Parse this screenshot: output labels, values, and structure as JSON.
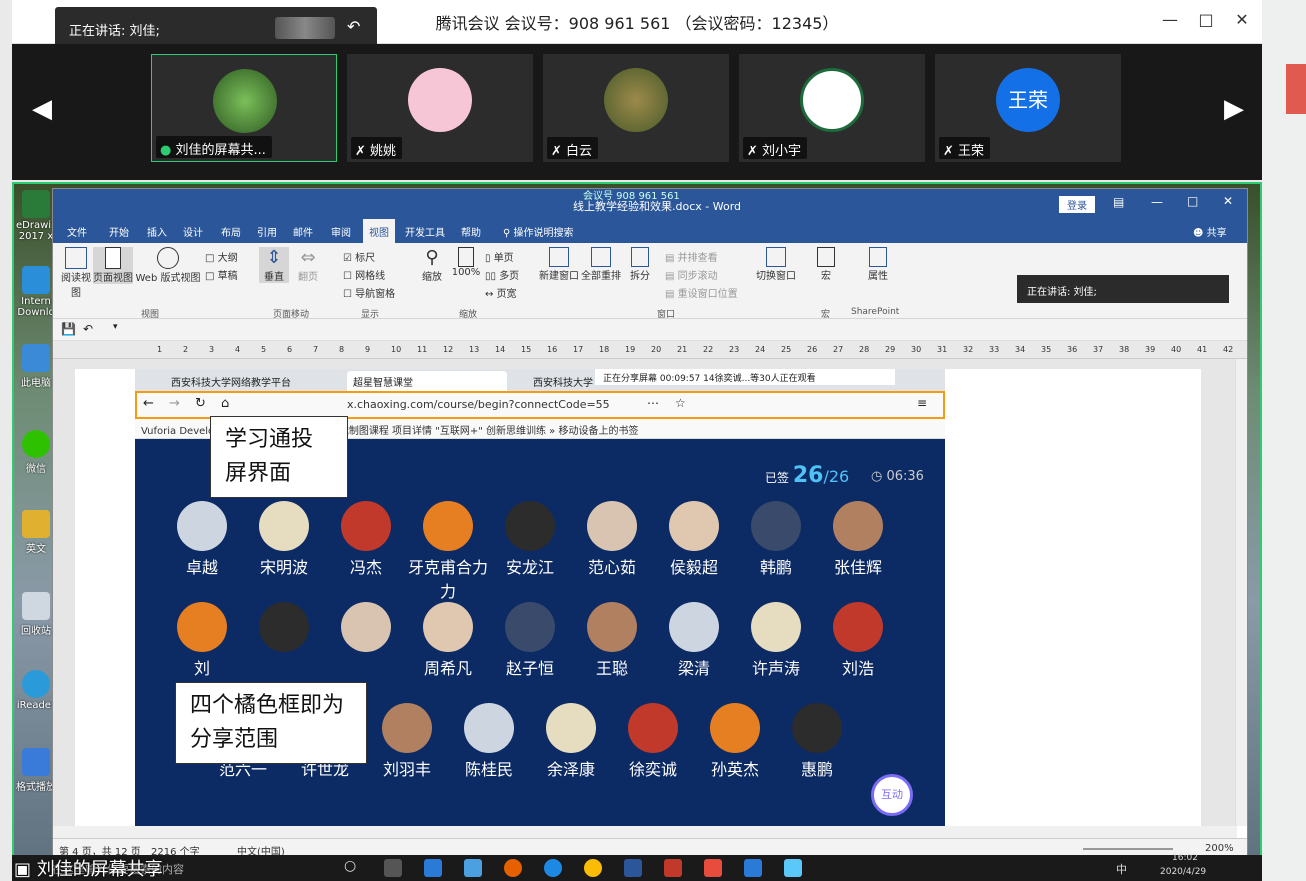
{
  "meeting": {
    "title": "腾讯会议 会议号：908 961 561 （会议密码：12345）",
    "speaking": "正在讲话: 刘佳;"
  },
  "participants": [
    {
      "name": "刘佳的屏幕共...",
      "color": "#4b7a3a",
      "initial": ""
    },
    {
      "name": "姚姚",
      "color": "#f7c6d6",
      "initial": ""
    },
    {
      "name": "白云",
      "color": "#7a6a3a",
      "initial": ""
    },
    {
      "name": "刘小宇",
      "color": "#ffffff",
      "initial": ""
    },
    {
      "name": "王荣",
      "color": "#1470e6",
      "initial": "王荣"
    }
  ],
  "desktop_icons": [
    "eDrawing 2017 x",
    "Intern Downlo",
    "此电脑",
    "微信",
    "英文",
    "回收站",
    "iReader",
    "格式播放"
  ],
  "word": {
    "meeting_line": "会议号 908 961 561",
    "title": "线上教学经验和效果.docx - Word",
    "login": "登录",
    "tabs": [
      "文件",
      "开始",
      "插入",
      "设计",
      "布局",
      "引用",
      "邮件",
      "审阅",
      "视图",
      "开发工具",
      "帮助",
      "操作说明搜索"
    ],
    "share": "共享",
    "speaking_overlay": "正在讲话: 刘佳;",
    "ribbon": {
      "read_mode": "阅读视图",
      "print_layout": "页面视图",
      "web_layout": "Web 版式视图",
      "outline": "大纲",
      "draft": "草稿",
      "vertical": "垂直",
      "side": "翻页",
      "ruler": "标尺",
      "gridlines": "网格线",
      "nav_pane": "导航窗格",
      "zoom": "缩放",
      "zoom100": "100%",
      "one_page": "单页",
      "multi_page": "多页",
      "page_width": "页宽",
      "new_window": "新建窗口",
      "arrange_all": "全部重排",
      "split": "拆分",
      "side_by_side": "并排查看",
      "sync_scroll": "同步滚动",
      "reset_pos": "重设窗口位置",
      "switch_windows": "切换窗口",
      "macros": "宏",
      "properties": "属性",
      "groups": [
        "视图",
        "页面移动",
        "显示",
        "缩放",
        "窗口",
        "宏",
        "SharePoint"
      ]
    },
    "status": {
      "page": "第 4 页，共 12 页",
      "words": "2216 个字",
      "lang": "中文(中国)",
      "zoom": "200%"
    }
  },
  "browser": {
    "tabs": [
      "西安科技大学网络教学平台",
      "超星智慧课堂",
      "西安科技大学"
    ],
    "recording": "正在分享屏幕   00:09:57     14徐奕诚...等30人正在观看",
    "url": "x.chaoxing.com/course/begin?connectCode=55",
    "bookmarks": "Vuforia Develo   fir.im 帐号登录   如何讲好机械制图课程   项目详情  \"互联网+\"   创新思维训练   » 移动设备上的书签",
    "signed_label": "已签",
    "signed_count": "26",
    "signed_total": "/26",
    "timer": "06:36",
    "interact": "互动"
  },
  "students": [
    [
      "卓越",
      "宋明波",
      "冯杰",
      "牙克甫合力力",
      "安龙江",
      "范心茹",
      "侯毅超",
      "韩鹏",
      "张佳辉"
    ],
    [
      "刘",
      "",
      "",
      "周希凡",
      "赵子恒",
      "王聪",
      "梁清",
      "许声涛",
      "刘浩"
    ],
    [
      "范六一",
      "许世龙",
      "刘羽丰",
      "陈桂民",
      "余泽康",
      "徐奕诚",
      "孙英杰",
      "惠鹏"
    ]
  ],
  "notes": {
    "n1": "学习通投屏界面",
    "n2": "四个橘色框即为分享范围"
  },
  "taskbar": {
    "search": "在这里输入你要搜索的内容",
    "time": "16:02",
    "date": "2020/4/29",
    "ime": "中"
  },
  "share_owner": "刘佳的屏幕共享"
}
